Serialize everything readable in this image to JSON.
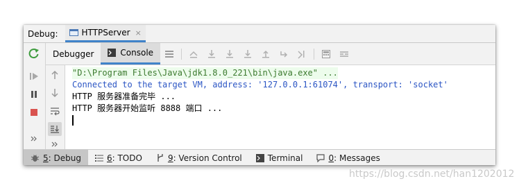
{
  "header": {
    "label": "Debug:",
    "tab_title": "HTTPServer",
    "tab_close": "×"
  },
  "subtabs": {
    "debugger_label": "Debugger",
    "console_label": "Console"
  },
  "console": {
    "lines": [
      "\"D:\\Program Files\\Java\\jdk1.8.0_221\\bin\\java.exe\" ...",
      "Connected to the target VM, address: '127.0.0.1:61074', transport: 'socket'",
      "HTTP 服务器准备完毕 ...",
      "HTTP 服务器开始监听 8888 端口 ..."
    ]
  },
  "bottom_bar": {
    "debug": {
      "mnemonic": "5",
      "label": ": Debug"
    },
    "todo": {
      "mnemonic": "6",
      "label": ": TODO"
    },
    "version_control": {
      "mnemonic": "9",
      "label": ": Version Control"
    },
    "terminal": {
      "label": "Terminal"
    },
    "messages": {
      "mnemonic": "0",
      "label": ": Messages"
    }
  },
  "watermark": "https://blog.csdn.net/han1202012",
  "colors": {
    "accent_blue": "#4083c9",
    "rerun_green": "#3d9b3d",
    "stop_red": "#d9534f",
    "console_cmd_green": "#3c7a2f",
    "console_connected_blue": "#2b55c4"
  },
  "icons": {
    "rerun": "rerun-icon",
    "resume": "resume-icon",
    "pause": "pause-icon",
    "stop": "stop-icon",
    "more": "more-icon"
  }
}
